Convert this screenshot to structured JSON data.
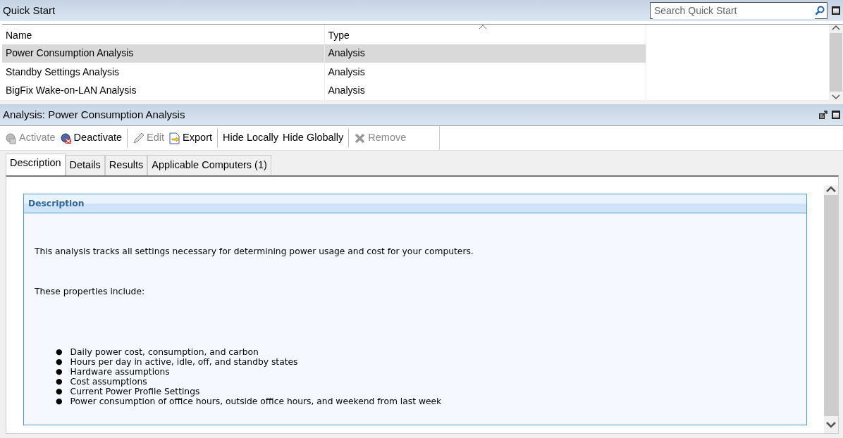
{
  "quick_start": {
    "title": "Quick Start",
    "search": {
      "placeholder": "Search Quick Start"
    },
    "table": {
      "columns": [
        "Name",
        "Type"
      ],
      "rows": [
        {
          "name": "Power Consumption Analysis",
          "type": "Analysis",
          "selected": true
        },
        {
          "name": "Standby Settings Analysis",
          "type": "Analysis",
          "selected": false
        },
        {
          "name": "BigFix Wake-on-LAN Analysis",
          "type": "Analysis",
          "selected": false
        }
      ]
    }
  },
  "analysis": {
    "title": "Analysis: Power Consumption Analysis",
    "toolbar": [
      [
        {
          "label": "Activate",
          "kind": "activate",
          "disabled": true
        },
        {
          "label": "Deactivate",
          "kind": "deactivate",
          "disabled": false
        }
      ],
      [
        {
          "label": "Edit",
          "kind": "edit",
          "disabled": true
        },
        {
          "label": "Export",
          "kind": "export",
          "disabled": false
        }
      ],
      [
        {
          "label": "Hide Locally",
          "disabled": false
        },
        {
          "label": "Hide Globally",
          "disabled": false
        }
      ],
      [
        {
          "label": "Remove",
          "kind": "remove",
          "disabled": true
        }
      ]
    ],
    "tabs": [
      {
        "label": "Description",
        "selected": true
      },
      {
        "label": "Details",
        "selected": false
      },
      {
        "label": "Results",
        "selected": false
      },
      {
        "label": "Applicable Computers (1)",
        "selected": false
      }
    ],
    "description": {
      "heading": "Description",
      "paragraphs": [
        "This analysis tracks all settings necessary for determining power usage and cost for your computers.",
        "These properties include:"
      ],
      "bullets": [
        {
          "marker": "●",
          "text": "Daily power cost, consumption, and carbon"
        },
        {
          "marker": "●",
          "text": "Hours per day in active, idle, off, and standby states"
        },
        {
          "marker": "●",
          "text": "Hardware assumptions"
        },
        {
          "marker": "●",
          "text": "Cost assumptions"
        },
        {
          "marker": "●",
          "text": "Current Power Profile Settings"
        },
        {
          "marker": "●",
          "text": "Power consumption of office hours, outside office hours, and weekend from last week"
        }
      ]
    }
  }
}
